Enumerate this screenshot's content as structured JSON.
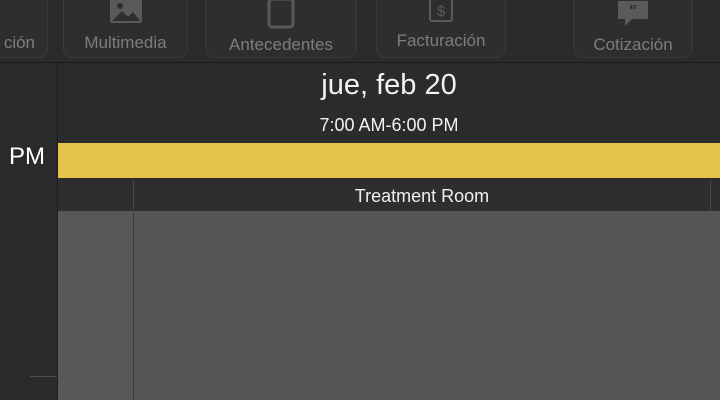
{
  "toolbar": {
    "items": [
      {
        "label": "ción",
        "icon": "doc-icon"
      },
      {
        "label": "Multimedia",
        "icon": "image-icon"
      },
      {
        "label": "Antecedentes",
        "icon": "tablet-icon"
      },
      {
        "label": "Facturación",
        "icon": "dollar-doc-icon"
      },
      {
        "label": "Cotización",
        "icon": "quote-bubble-icon"
      }
    ]
  },
  "timecol": {
    "pm_label": "PM"
  },
  "calendar": {
    "date": "jue, feb 20",
    "hours": "7:00 AM-6:00 PM",
    "room": "Treatment Room",
    "allday_color": "#e6c44b"
  }
}
